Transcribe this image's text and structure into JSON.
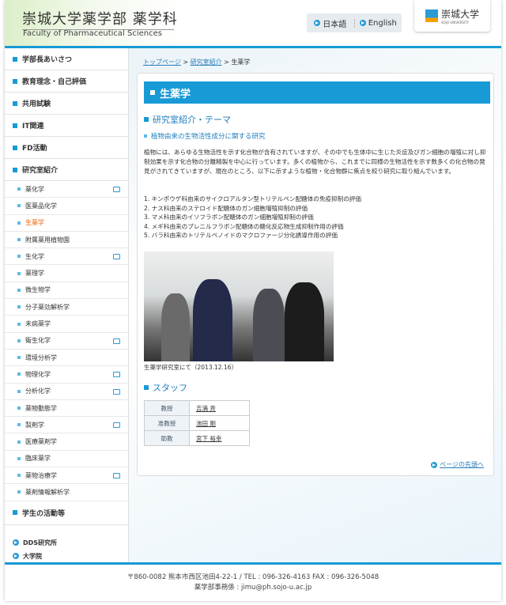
{
  "header": {
    "title": "崇城大学薬学部 薬学科",
    "subtitle": "Faculty of Pharmaceutical Sciences",
    "lang": [
      "日本語",
      "English"
    ],
    "logo_text": "崇城大学",
    "logo_sub": "SOJO UNIVERSITY"
  },
  "sidebar": {
    "top": [
      "学部長あいさつ",
      "教育理念・自己評価",
      "共用試験",
      "IT関連",
      "FD活動",
      "研究室紹介"
    ],
    "sub": [
      {
        "label": "薬化学",
        "win": true
      },
      {
        "label": "医薬品化学"
      },
      {
        "label": "生薬学",
        "active": true
      },
      {
        "label": "附属薬用植物園"
      },
      {
        "label": "生化学",
        "win": true
      },
      {
        "label": "薬理学"
      },
      {
        "label": "微生物学"
      },
      {
        "label": "分子薬効解析学"
      },
      {
        "label": "未病薬学"
      },
      {
        "label": "衛生化学",
        "win": true
      },
      {
        "label": "環境分析学"
      },
      {
        "label": "物理化学",
        "win": true
      },
      {
        "label": "分析化学",
        "win": true
      },
      {
        "label": "薬物動態学"
      },
      {
        "label": "製剤学",
        "win": true
      },
      {
        "label": "医療薬剤学"
      },
      {
        "label": "臨床薬学"
      },
      {
        "label": "薬物治療学",
        "win": true
      },
      {
        "label": "薬剤情報解析学"
      }
    ],
    "bottom": "学生の活動等",
    "links": [
      "DDS研究所",
      "大学院"
    ]
  },
  "breadcrumb": [
    "トップページ",
    "研究室紹介",
    "生薬学"
  ],
  "main": {
    "title": "生薬学",
    "section1": "研究室紹介・テーマ",
    "theme": "植物由来の生物活性成分に関する研究",
    "paragraph": "植物には、あらゆる生物活性を示す化合物が含有されていますが、その中でも生体中に生じた炎症及びガン細胞の増殖に対し抑制効果を示す化合物の分離精製を中心に行っています。多くの植物から、これまでに同様の生物活性を示す数多くの化合物の発見がされてきていますが、現在のところ、以下に示すような植物・化合物群に焦点を絞り研究に取り組んでいます。",
    "list": [
      "1. キンポウゲ科由来のサイクロアルタン型トリテルペン配糖体の免疫抑制の評価",
      "2. ナス科由来のステロイド配糖体のガン細胞増殖抑制の評価",
      "3. マメ科由来のイソフラボン配糖体のガン細胞増殖抑制の評価",
      "4. メギ科由来のプレニルフラボン配糖体の糖化反応物生成抑制作用の評価",
      "5. バラ科由来のトリテルペノイドのマクロファージ分化誘導作用の評価"
    ],
    "caption": "生薬学研究室にて（2013.12.16）",
    "section2": "スタッフ",
    "staff": [
      {
        "role": "教授",
        "name": "吉満 斉"
      },
      {
        "role": "准教授",
        "name": "池田 剛"
      },
      {
        "role": "助教",
        "name": "宮下 裕幸"
      }
    ],
    "to_top": "ページの先頭へ"
  },
  "footer": {
    "line1": "〒860-0082 熊本市西区池田4-22-1 / TEL : 096-326-4163 FAX : 096-326-5048",
    "line2": "薬学部事務係 : jimu@ph.sojo-u.ac.jp"
  }
}
